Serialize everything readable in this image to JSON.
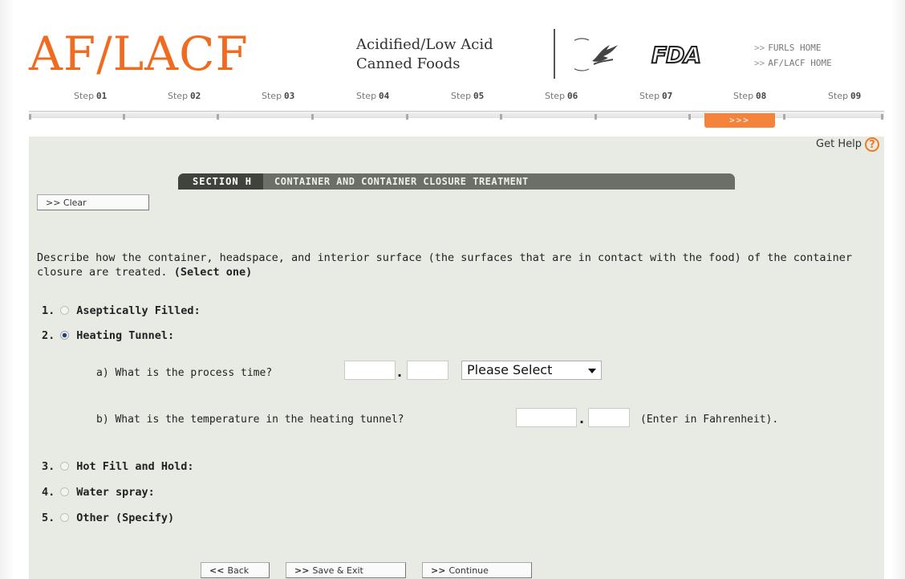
{
  "header": {
    "logo": "AF/LACF",
    "subtitle_line1": "Acidified/Low Acid",
    "subtitle_line2": "Canned Foods",
    "agency_logo": "FDA",
    "links": [
      "FURLS HOME",
      "AF/LACF HOME"
    ],
    "link_arrow": ">>"
  },
  "steps": {
    "items": [
      {
        "label": "Step",
        "num": "01"
      },
      {
        "label": "Step",
        "num": "02"
      },
      {
        "label": "Step",
        "num": "03"
      },
      {
        "label": "Step",
        "num": "04"
      },
      {
        "label": "Step",
        "num": "05"
      },
      {
        "label": "Step",
        "num": "06"
      },
      {
        "label": "Step",
        "num": "07"
      },
      {
        "label": "Step",
        "num": "08"
      },
      {
        "label": "Step",
        "num": "09"
      }
    ],
    "current_indicator": ">>>",
    "current_index": 8
  },
  "panel": {
    "get_help": "Get Help",
    "help_glyph": "?",
    "section_id": "SECTION H",
    "section_title": "CONTAINER AND CONTAINER CLOSURE TREATMENT",
    "clear_button": ">> Clear",
    "question": "Describe how the container, headspace, and interior surface (the surfaces that are in contact with the food) of the container closure are treated.",
    "question_hint": "(Select one)",
    "options": [
      {
        "num": "1.",
        "label": "Aseptically Filled:",
        "selected": false
      },
      {
        "num": "2.",
        "label": "Heating Tunnel:",
        "selected": true
      },
      {
        "num": "3.",
        "label": "Hot Fill and Hold:",
        "selected": false
      },
      {
        "num": "4.",
        "label": "Water spray:",
        "selected": false
      },
      {
        "num": "5.",
        "label": "Other (Specify)",
        "selected": false
      }
    ],
    "sub_a": "a) What is the process time?",
    "sub_a_time_value": "",
    "sub_a_time_decimal": "",
    "sub_a_unit_select": "Please Select",
    "sub_b": "b) What is the temperature in the heating tunnel?",
    "sub_b_temp_value": "",
    "sub_b_temp_decimal": "",
    "sub_b_note": "(Enter in Fahrenheit).",
    "decimal_sep": "."
  },
  "footer": {
    "back": "Back",
    "back_arrow": "<<",
    "save_exit": "Save & Exit",
    "continue": "Continue",
    "fwd_arrow": ">>"
  },
  "colors": {
    "brand_orange": "#f06b1f",
    "panel_bg": "#e8ebe3",
    "section_tab_dark": "#3f433c",
    "section_tab": "#6b6f65"
  }
}
